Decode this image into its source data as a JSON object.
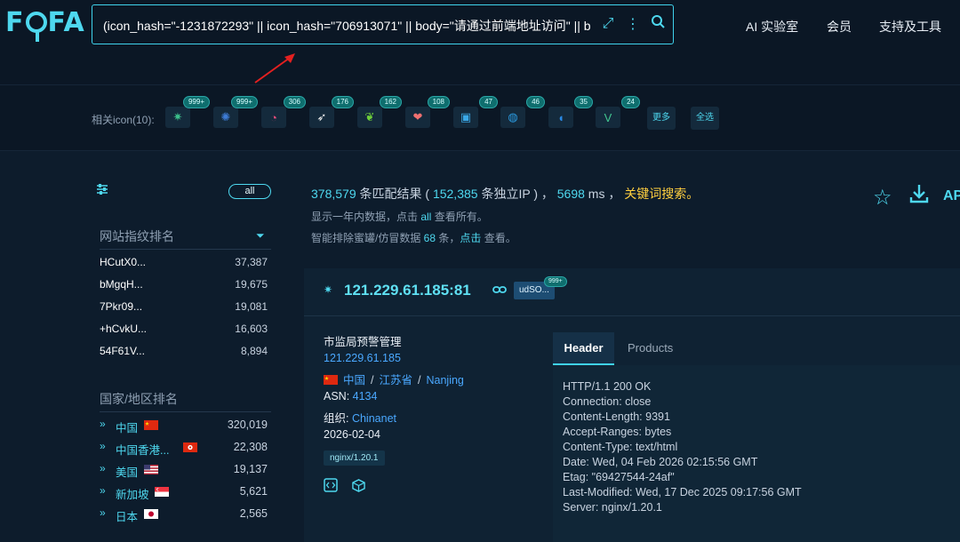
{
  "logo": "FOFA",
  "search": {
    "query": "(icon_hash=\"-1231872293\" || icon_hash=\"706913071\" || body=\"请通过前端地址访问\" || b"
  },
  "nav": [
    "AI 实验室",
    "会员",
    "支持及工具"
  ],
  "related_icons": {
    "label": "相关icon(10):",
    "items": [
      {
        "icon": "leaf-icon",
        "glyph": "✷",
        "color": "#3cbf8a",
        "badge": "999+"
      },
      {
        "icon": "lotus-icon",
        "glyph": "✺",
        "color": "#3d7cd6",
        "badge": "999+"
      },
      {
        "icon": "rainbow-icon",
        "glyph": "◔",
        "color": "#e84c7a",
        "badge": "306"
      },
      {
        "icon": "rocket-icon",
        "glyph": "➶",
        "color": "#f0f0f0",
        "badge": "176"
      },
      {
        "icon": "spring-leaf-icon",
        "glyph": "❦",
        "color": "#6fcf3a",
        "badge": "162"
      },
      {
        "icon": "heart-icon",
        "glyph": "❤",
        "color": "#f07070",
        "badge": "108"
      },
      {
        "icon": "monitor-icon",
        "glyph": "▣",
        "color": "#3aa8e6",
        "badge": "47"
      },
      {
        "icon": "globe-icon",
        "glyph": "◍",
        "color": "#2a9adf",
        "badge": "46"
      },
      {
        "icon": "drop-icon",
        "glyph": "◖",
        "color": "#2a8ae6",
        "badge": "35"
      },
      {
        "icon": "vue-icon",
        "glyph": "V",
        "color": "#42c690",
        "badge": "24"
      }
    ],
    "more_label": "更多",
    "all_label": "全选"
  },
  "sidebar": {
    "all_pill": "all",
    "fingerprint_title": "网站指纹排名",
    "fingerprints": [
      {
        "name": "HCutX0...",
        "count": "37,387"
      },
      {
        "name": "bMgqH...",
        "count": "19,675"
      },
      {
        "name": "7Pkr09...",
        "count": "19,081"
      },
      {
        "name": "+hCvkU...",
        "count": "16,603"
      },
      {
        "name": "54F61V...",
        "count": "8,894"
      }
    ],
    "country_title": "国家/地区排名",
    "countries": [
      {
        "name": "中国",
        "count": "320,019",
        "flag": "cn"
      },
      {
        "name": "中国香港...",
        "count": "22,308",
        "flag": "hk"
      },
      {
        "name": "美国",
        "count": "19,137",
        "flag": "us"
      },
      {
        "name": "新加坡",
        "count": "5,621",
        "flag": "sg"
      },
      {
        "name": "日本",
        "count": "2,565",
        "flag": "jp"
      }
    ]
  },
  "summary": {
    "matches": "378,579",
    "matches_suffix": " 条匹配结果 ( ",
    "unique_ips": "152,385",
    "unique_suffix": " 条独立IP ) ，",
    "time": "5698",
    "time_suffix": " ms ，",
    "keyword_search": "关键词搜索。",
    "line2_prefix": "显示一年内数据，点击 ",
    "line2_link": "all",
    "line2_suffix": " 查看所有。",
    "line3_prefix": "智能排除蜜罐/仿冒数据 ",
    "line3_count": "68",
    "line3_mid": " 条，",
    "line3_link": "点击",
    "line3_suffix": " 查看。",
    "api_label": "AP"
  },
  "result": {
    "ip_port": "121.229.61.185:81",
    "tag": "udSO...",
    "tag_badge": "999+",
    "title": "市监局预警管理",
    "ip": "121.229.61.185",
    "country": "中国",
    "province": "江苏省",
    "city": "Nanjing",
    "asn_label": "ASN: ",
    "asn": "4134",
    "org_label": "组织: ",
    "org": "Chinanet",
    "date": "2026-02-04",
    "server": "nginx/1.20.1",
    "tabs": [
      "Header",
      "Products"
    ],
    "header_lines": [
      "HTTP/1.1 200 OK",
      "Connection: close",
      "Content-Length: 9391",
      "Accept-Ranges: bytes",
      "Content-Type: text/html",
      "Date: Wed, 04 Feb 2026 02:15:56 GMT",
      "Etag: \"69427544-24af\"",
      "Last-Modified: Wed, 17 Dec 2025 09:17:56 GMT",
      "Server: nginx/1.20.1"
    ]
  }
}
